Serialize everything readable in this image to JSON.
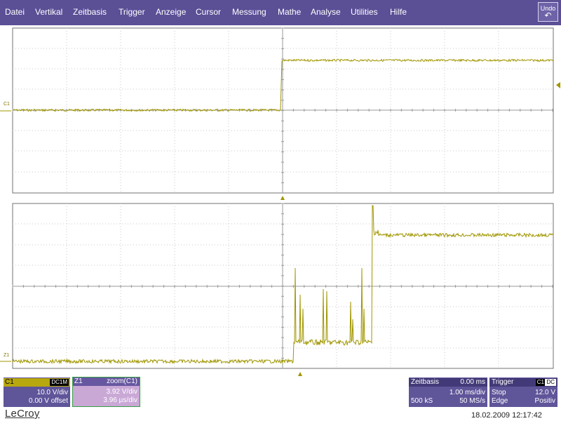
{
  "menu": {
    "items": [
      "Datei",
      "Vertikal",
      "Zeitbasis",
      "Trigger",
      "Anzeige",
      "Cursor",
      "Messung",
      "Mathe",
      "Analyse",
      "Utilities",
      "Hilfe"
    ],
    "undo_label": "Undo"
  },
  "traces": {
    "upper_label": "C1",
    "lower_label": "Z1"
  },
  "colors": {
    "trace": "#a09600",
    "menu": "#5b4f96",
    "panel": "#5f5599",
    "zoom_panel": "#c9a8d6"
  },
  "c1_panel": {
    "name": "C1",
    "coupling": "DC1M",
    "vdiv": "10.0 V/div",
    "offset": "0.00 V offset"
  },
  "z1_panel": {
    "name": "Z1",
    "source": "zoom(C1)",
    "vdiv": "3.92 V/div",
    "tdiv": "3.96 µs/div"
  },
  "timebase": {
    "title": "Zeitbasis",
    "delay": "0.00 ms",
    "tdiv": "1.00 ms/div",
    "samples": "500 kS",
    "rate": "50 MS/s"
  },
  "trigger": {
    "title": "Trigger",
    "source": "C1",
    "coupling": "DC",
    "mode": "Stop",
    "level": "12.0 V",
    "type": "Edge",
    "slope": "Positiv"
  },
  "footer": {
    "brand": "LeCroy",
    "datetime": "18.02.2009 12:17:42"
  }
}
